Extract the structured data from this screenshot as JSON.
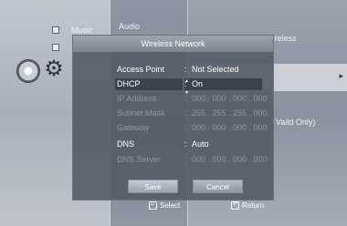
{
  "background": {
    "left_menu": {
      "music": "Music"
    },
    "middle_menu": {
      "audio": "Audio"
    },
    "right_panel": {
      "title": "Network Selection : Wireless",
      "note": "Vaild Only)"
    }
  },
  "dialog": {
    "title": "Wireless Network",
    "rows": [
      {
        "label": "Access Point",
        "value": "Not Selected",
        "enabled": true
      },
      {
        "label": "DHCP",
        "value": "On",
        "enabled": true,
        "selected": true
      },
      {
        "label": "IP Address",
        "value": "000 . 000 . 000 . 000",
        "enabled": false
      },
      {
        "label": "Subnet Mask",
        "value": "255 . 255 . 255 . 000",
        "enabled": false
      },
      {
        "label": "Gateway",
        "value": "000 . 000 . 000 . 000",
        "enabled": false
      },
      {
        "label": "DNS",
        "value": "Auto",
        "enabled": true
      },
      {
        "label": "DNS Server",
        "value": "000 . 000 . 000 . 000",
        "enabled": false
      }
    ],
    "buttons": {
      "save": "Save",
      "cancel": "Cancel"
    }
  },
  "footer": {
    "select": "Select",
    "return": "Return"
  }
}
